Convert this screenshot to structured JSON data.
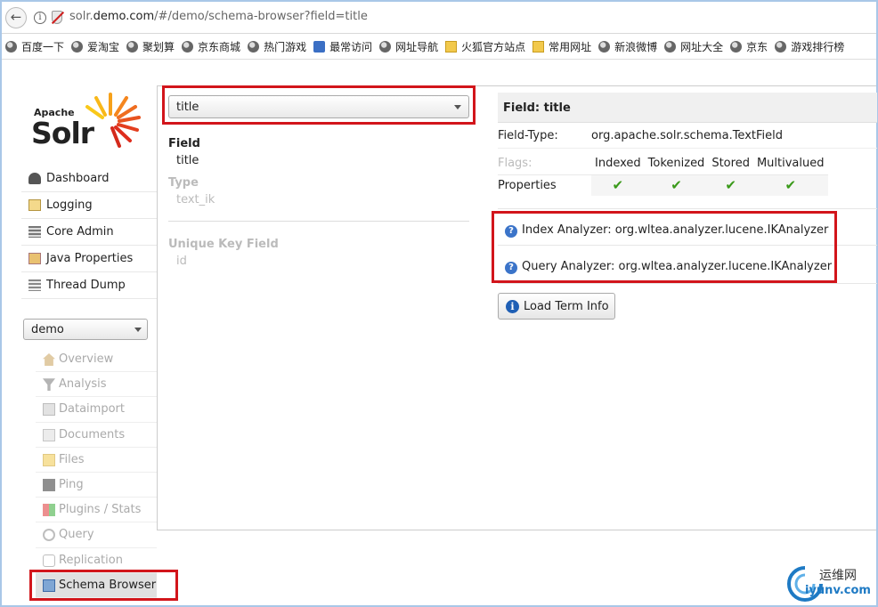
{
  "browser": {
    "url_prefix": "solr.",
    "url_domain": "demo.com",
    "url_path": "/#/demo/schema-browser?field=title",
    "bookmarks": [
      {
        "label": "百度一下",
        "icon": "globe-icon"
      },
      {
        "label": "爱淘宝",
        "icon": "globe-icon"
      },
      {
        "label": "聚划算",
        "icon": "globe-icon"
      },
      {
        "label": "京东商城",
        "icon": "globe-icon"
      },
      {
        "label": "热门游戏",
        "icon": "globe-icon"
      },
      {
        "label": "最常访问",
        "icon": "search-icon"
      },
      {
        "label": "网址导航",
        "icon": "globe-icon"
      },
      {
        "label": "火狐官方站点",
        "icon": "folder-icon"
      },
      {
        "label": "常用网址",
        "icon": "folder-icon"
      },
      {
        "label": "新浪微博",
        "icon": "globe-icon"
      },
      {
        "label": "网址大全",
        "icon": "globe-icon"
      },
      {
        "label": "京东",
        "icon": "globe-icon"
      },
      {
        "label": "游戏排行榜",
        "icon": "globe-icon"
      }
    ]
  },
  "logo": {
    "apache": "Apache",
    "solr": "Solr"
  },
  "nav": {
    "items": [
      {
        "label": "Dashboard",
        "icon": "dashboard-icon"
      },
      {
        "label": "Logging",
        "icon": "logging-icon"
      },
      {
        "label": "Core Admin",
        "icon": "core-admin-icon"
      },
      {
        "label": "Java Properties",
        "icon": "java-icon"
      },
      {
        "label": "Thread Dump",
        "icon": "thread-dump-icon"
      }
    ],
    "core_selected": "demo",
    "core_items": [
      {
        "label": "Overview",
        "icon": "home-icon"
      },
      {
        "label": "Analysis",
        "icon": "funnel-icon"
      },
      {
        "label": "Dataimport",
        "icon": "import-icon"
      },
      {
        "label": "Documents",
        "icon": "documents-icon"
      },
      {
        "label": "Files",
        "icon": "folder-icon"
      },
      {
        "label": "Ping",
        "icon": "ping-icon"
      },
      {
        "label": "Plugins / Stats",
        "icon": "plugins-icon"
      },
      {
        "label": "Query",
        "icon": "magnifier-icon"
      },
      {
        "label": "Replication",
        "icon": "replication-icon"
      },
      {
        "label": "Schema Browser",
        "icon": "book-icon"
      }
    ]
  },
  "schema": {
    "field_select": "title",
    "field_label": "Field",
    "field_value": "title",
    "type_label": "Type",
    "type_value": "text_ik",
    "unique_label": "Unique Key Field",
    "unique_value": "id",
    "header": "Field: title",
    "field_type_label": "Field-Type:",
    "field_type_value": "org.apache.solr.schema.TextField",
    "flags_label": "Flags:",
    "flag_headers": [
      "Indexed",
      "Tokenized",
      "Stored",
      "Multivalued"
    ],
    "properties_label": "Properties",
    "index_analyzer": "Index Analyzer: org.wltea.analyzer.lucene.IKAnalyzer",
    "query_analyzer": "Query Analyzer: org.wltea.analyzer.lucene.IKAnalyzer",
    "load_term_info": "Load Term Info"
  },
  "watermark": {
    "cn": "运维网",
    "en": "iyunv.com"
  },
  "colors": {
    "highlight_box": "#d2151b",
    "check": "#3a9a1a",
    "info": "#1f5fb5"
  }
}
